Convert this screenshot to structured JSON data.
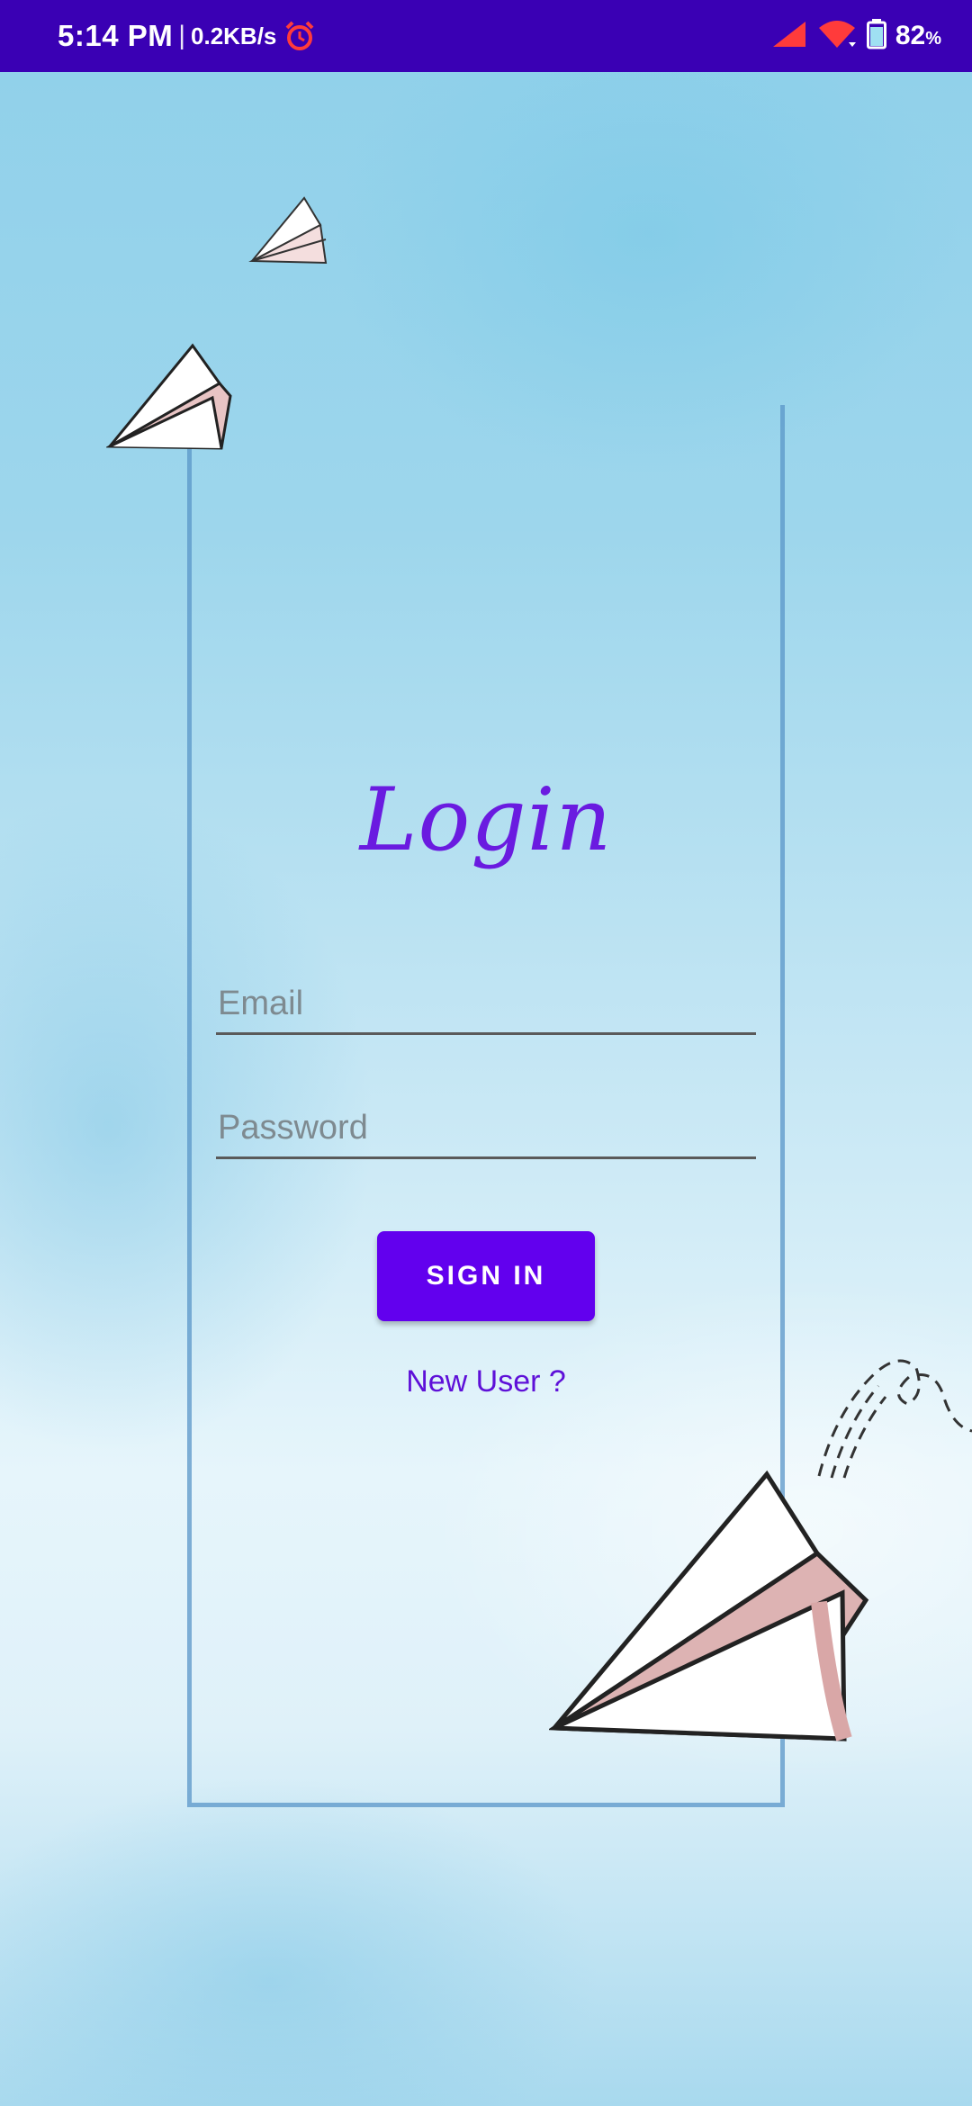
{
  "status_bar": {
    "time": "5:14 PM",
    "separator": "|",
    "net_speed": "0.2KB/s",
    "battery": "82",
    "battery_unit": "%",
    "icons": [
      "alarm-icon",
      "signal-icon",
      "wifi-icon",
      "battery-icon"
    ]
  },
  "login": {
    "title": "Login",
    "email_placeholder": "Email",
    "password_placeholder": "Password",
    "signin_label": "SIGN IN",
    "new_user_label": "New User ?"
  },
  "colors": {
    "status_bar": "#3a00b4",
    "accent": "#6200ee",
    "title": "#6a1be0"
  }
}
